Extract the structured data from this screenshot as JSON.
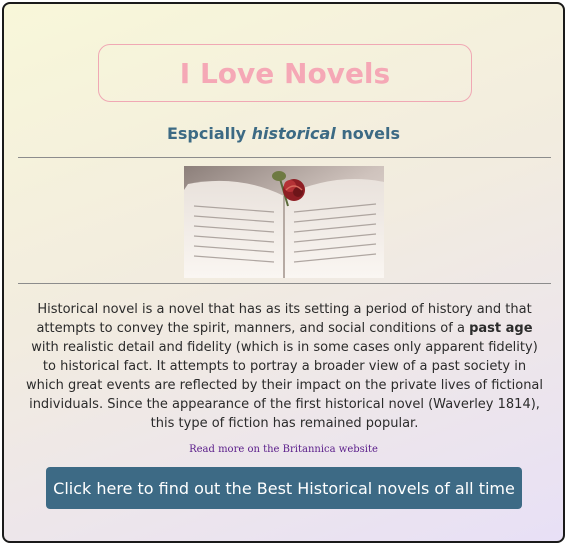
{
  "header": {
    "title": "I Love Novels",
    "subtitle_prefix": "Espcially ",
    "subtitle_emphasis": "historical",
    "subtitle_suffix": " novels"
  },
  "image": {
    "name": "open-book-with-rose"
  },
  "body": {
    "text_part1": "Historical novel is a novel that has as its setting a period of history and that attempts to convey the spirit, manners, and social conditions of a ",
    "text_bold": "past age",
    "text_part2": " with realistic detail and fidelity (which is in some cases only apparent fidelity) to historical fact. It attempts to portray a broader view of a past society in which great events are reflected by their impact on the private lives of fictional individuals. Since the appearance of the first historical novel (Waverley 1814), this type of fiction has remained popular.",
    "link_text": "Read more on the Britannica website"
  },
  "cta": {
    "label": "Click here to find out the Best Historical novels of all time"
  },
  "colors": {
    "title": "#f5a8b6",
    "subtitle": "#3c6a84",
    "button": "#3d6a85",
    "link": "#5a1d8a"
  }
}
